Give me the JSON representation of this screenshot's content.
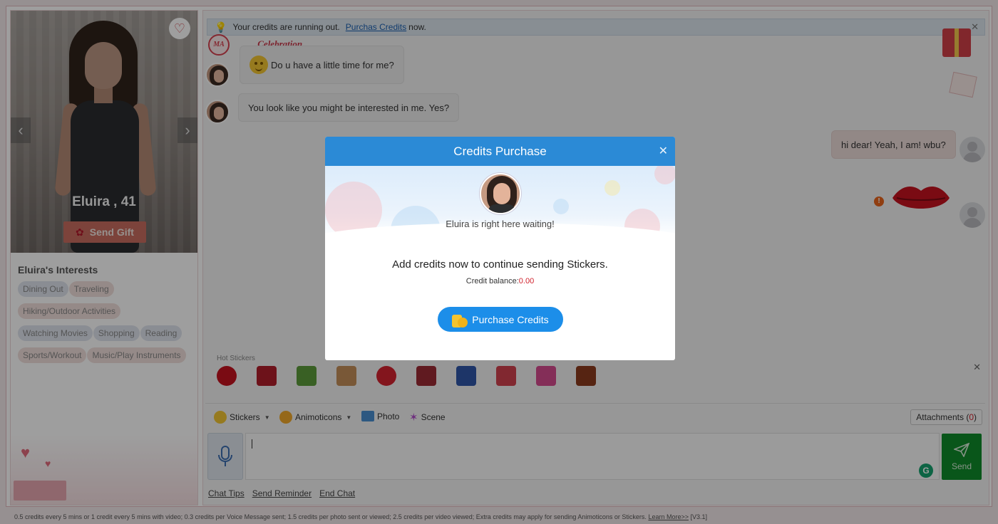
{
  "profile": {
    "name": "Eluira , 41",
    "send_gift_label": "Send Gift",
    "interests_title": "Eluira's Interests",
    "interests": [
      {
        "label": "Dining Out",
        "color": "blue"
      },
      {
        "label": "Traveling",
        "color": "pink"
      },
      {
        "label": "Hiking/Outdoor Activities",
        "color": "pink"
      },
      {
        "label": "Watching Movies",
        "color": "blue"
      },
      {
        "label": "Shopping",
        "color": "blue"
      },
      {
        "label": "Reading",
        "color": "blue"
      },
      {
        "label": "Sports/Workout",
        "color": "pink"
      },
      {
        "label": "Music/Play Instruments",
        "color": "pink"
      }
    ]
  },
  "notice": {
    "text": "Your credits are running out.",
    "link": "Purchas Credits",
    "suffix": "now."
  },
  "chat": {
    "celebration_badge": "MA",
    "celebration_label": "Celebration",
    "messages": [
      {
        "from": "her",
        "text": "Do u have a little time for me?",
        "has_emoji": true
      },
      {
        "from": "her",
        "text": "You look like you might be interested in me. Yes?"
      },
      {
        "from": "me",
        "text": "hi dear! Yeah, I am! wbu?"
      }
    ]
  },
  "hot_stickers": {
    "label": "Hot Stickers",
    "items": [
      "lips",
      "rose",
      "frog-sign",
      "monkey",
      "kiss-red",
      "cake",
      "blue-rose",
      "tulips",
      "heart-arrow",
      "photo-card"
    ]
  },
  "toolbar": {
    "stickers": "Stickers",
    "animoticons": "Animoticons",
    "photo": "Photo",
    "scene": "Scene",
    "attachments_label": "Attachments (",
    "attachments_count": "0",
    "attachments_close": ")"
  },
  "composer": {
    "send_label": "Send"
  },
  "links": {
    "chat_tips": "Chat Tips",
    "send_reminder": "Send Reminder",
    "end_chat": "End Chat"
  },
  "footer": {
    "text": "0.5 credits every 5 mins or 1 credit every 5 mins with video; 0.3 credits per Voice Message sent; 1.5 credits per photo sent or viewed; 2.5 credits per video viewed; Extra credits may apply for sending Animoticons or Stickers.",
    "learn_more": "Learn More>>",
    "version": "[V3.1]"
  },
  "modal": {
    "title": "Credits Purchase",
    "waiting": "Eluira is right here waiting!",
    "message": "Add credits now to continue sending Stickers.",
    "balance_label": "Credit balance:",
    "balance_value": "0.00",
    "purchase_label": "Purchase Credits"
  },
  "colors": {
    "modal_header": "#2b8ad6",
    "purchase_button": "#1c8ee9",
    "send_button": "#0f8c2b",
    "balance_value": "#d0202b"
  }
}
